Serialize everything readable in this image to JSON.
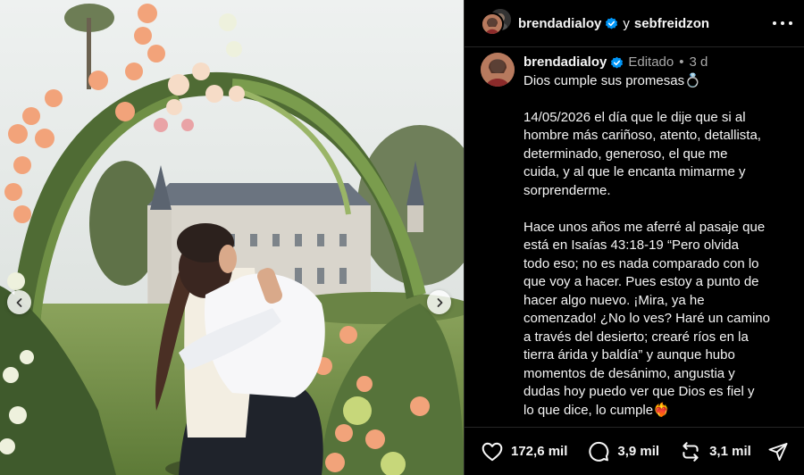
{
  "header": {
    "user_primary": "brendadialoy",
    "connector": "y",
    "user_secondary": "sebfreidzon",
    "more_icon": "more-horizontal-icon"
  },
  "caption": {
    "username": "brendadialoy",
    "edited_label": "Editado",
    "separator": "•",
    "timestamp": "3 d",
    "line1": "Dios cumple sus promesas💍",
    "para1": "14/05/2026 el día que le dije que si al\nhombre más cariñoso, atento, detallista,\ndeterminado, generoso, el que me\ncuida, y al que le encanta mimarme y\nsorprenderme.",
    "para2": "Hace unos años me aferré al pasaje que\nestá en Isaías 43:18-19 “Pero olvida\ntodo eso; no es nada comparado con lo\nque voy a hacer. Pues estoy a punto de\nhacer algo nuevo. ¡Mira, ya he\ncomenzado! ¿No lo ves? Haré un camino\na través del desierto; crearé ríos en la\ntierra árida y baldía” y aunque hubo\nmomentos de desánimo, angustia y\ndudas hoy puedo ver que Dios es fiel y\nlo que dice, lo cumple❤️‍🔥"
  },
  "actions": {
    "likes": "172,6 mil",
    "comments": "3,9 mil",
    "reposts": "3,1 mil"
  },
  "icons": {
    "like": "heart-icon",
    "comment": "comment-bubble-icon",
    "repost": "repost-icon",
    "share": "send-icon",
    "verified": "verified-badge-icon",
    "prev": "chevron-left-icon",
    "next": "chevron-right-icon"
  },
  "colors": {
    "background": "#000000",
    "text": "#f5f5f5",
    "muted": "#a8a8a8",
    "verified": "#0095f6",
    "divider": "#262626"
  }
}
